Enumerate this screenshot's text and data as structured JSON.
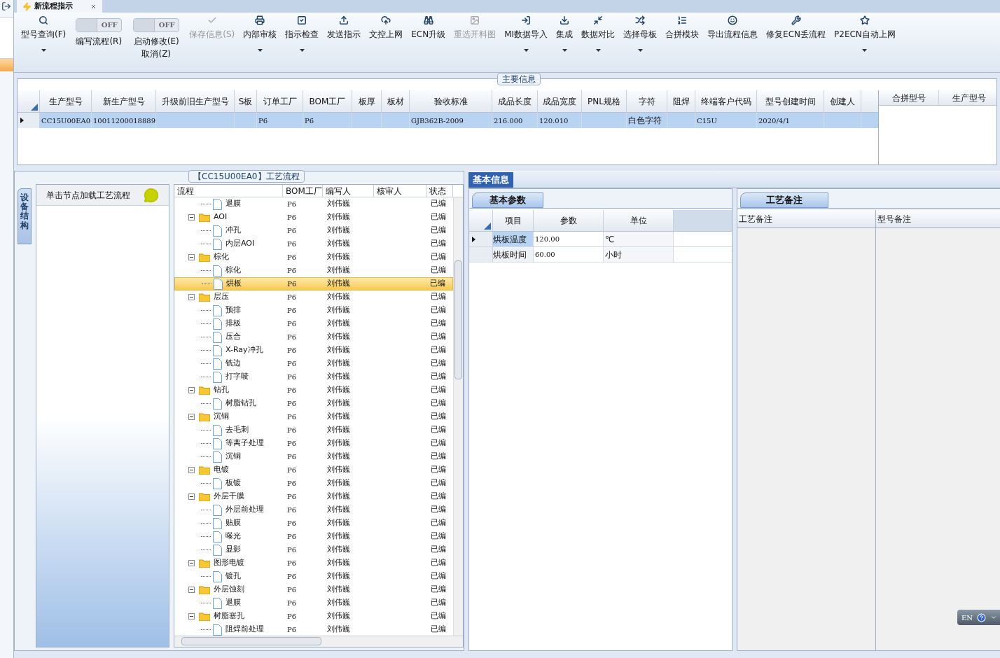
{
  "window": {
    "tab_title": "新流程指示"
  },
  "toolbar": [
    {
      "kind": "button",
      "label": "型号查询(F)",
      "disabled": false,
      "dropdown": true
    },
    {
      "kind": "toggle",
      "label": "编写流程(R)",
      "state_text": "OFF",
      "on": false
    },
    {
      "kind": "toggle",
      "label": "启动修改(E)",
      "sub_label": "取消(Z)",
      "state_text": "OFF",
      "on": false
    },
    {
      "kind": "button",
      "label": "保存信息(S)",
      "disabled": true,
      "dropdown": false
    },
    {
      "kind": "button",
      "label": "内部审核",
      "disabled": false,
      "dropdown": true
    },
    {
      "kind": "button",
      "label": "指示检查",
      "disabled": false,
      "dropdown": true
    },
    {
      "kind": "button",
      "label": "发送指示",
      "disabled": false,
      "dropdown": false
    },
    {
      "kind": "button",
      "label": "文控上网",
      "disabled": false,
      "dropdown": false
    },
    {
      "kind": "button",
      "label": "ECN升级",
      "disabled": false,
      "dropdown": false
    },
    {
      "kind": "button",
      "label": "重选开料图",
      "disabled": true,
      "dropdown": false
    },
    {
      "kind": "button",
      "label": "MI数据导入",
      "disabled": false,
      "dropdown": true
    },
    {
      "kind": "button",
      "label": "集成",
      "disabled": false,
      "dropdown": true
    },
    {
      "kind": "button",
      "label": "数据对比",
      "disabled": false,
      "dropdown": true
    },
    {
      "kind": "button",
      "label": "选择母板",
      "disabled": false,
      "dropdown": true
    },
    {
      "kind": "button",
      "label": "合拼模块",
      "disabled": false,
      "dropdown": false
    },
    {
      "kind": "button",
      "label": "导出流程信息",
      "disabled": false,
      "dropdown": false
    },
    {
      "kind": "button",
      "label": "修复ECN丢流程",
      "disabled": false,
      "dropdown": false
    },
    {
      "kind": "button",
      "label": "P2ECN自动上网",
      "disabled": false,
      "dropdown": true
    }
  ],
  "main_info": {
    "title": "主要信息",
    "columns": [
      "生产型号",
      "新生产型号",
      "升级前旧生产型号",
      "S板",
      "订单工厂",
      "BOM工厂",
      "板厚",
      "板材",
      "验收标准",
      "成品长度",
      "成品宽度",
      "PNL规格",
      "字符",
      "阻焊",
      "终端客户代码",
      "型号创建时间",
      "创建人"
    ],
    "rows": [
      {
        "selected": true,
        "cells": [
          "CC15U00EA0",
          "10011200018889",
          "",
          "",
          "P6",
          "P6",
          "",
          "",
          "GJB362B-2009",
          "216.000",
          "120.010",
          "",
          "白色字符",
          "",
          "C15U",
          "2020/4/1",
          ""
        ]
      }
    ],
    "side_columns": [
      "合拼型号",
      "生产型号"
    ]
  },
  "process": {
    "title": "【CC15U00EA0】工艺流程",
    "side_tab": "设备结构",
    "hint": "单击节点加载工艺流程",
    "columns": [
      "流程",
      "BOM工厂",
      "编写人",
      "核审人",
      "状态"
    ],
    "tree": [
      {
        "children": [
          {
            "label": "退膜",
            "bom": "P6",
            "writer": "刘伟巍",
            "status": "已编",
            "selected": false
          }
        ]
      },
      {
        "label": "AOI",
        "bom": "P6",
        "writer": "刘伟巍",
        "status": "已编",
        "expanded": true,
        "children": [
          {
            "label": "冲孔",
            "bom": "P6",
            "writer": "刘伟巍",
            "status": "已编",
            "selected": false
          },
          {
            "label": "内层AOI",
            "bom": "P6",
            "writer": "刘伟巍",
            "status": "已编",
            "selected": false
          }
        ]
      },
      {
        "label": "棕化",
        "bom": "P6",
        "writer": "刘伟巍",
        "status": "已编",
        "expanded": true,
        "children": [
          {
            "label": "棕化",
            "bom": "P6",
            "writer": "刘伟巍",
            "status": "已编",
            "selected": false
          },
          {
            "label": "烘板",
            "bom": "P6",
            "writer": "刘伟巍",
            "status": "已编",
            "selected": true
          }
        ]
      },
      {
        "label": "层压",
        "bom": "P6",
        "writer": "刘伟巍",
        "status": "已编",
        "expanded": true,
        "children": [
          {
            "label": "预排",
            "bom": "P6",
            "writer": "刘伟巍",
            "status": "已编",
            "selected": false
          },
          {
            "label": "排板",
            "bom": "P6",
            "writer": "刘伟巍",
            "status": "已编",
            "selected": false
          },
          {
            "label": "压合",
            "bom": "P6",
            "writer": "刘伟巍",
            "status": "已编",
            "selected": false
          },
          {
            "label": "X-Ray冲孔",
            "bom": "P6",
            "writer": "刘伟巍",
            "status": "已编",
            "selected": false
          },
          {
            "label": "铣边",
            "bom": "P6",
            "writer": "刘伟巍",
            "status": "已编",
            "selected": false
          },
          {
            "label": "打字唛",
            "bom": "P6",
            "writer": "刘伟巍",
            "status": "已编",
            "selected": false
          }
        ]
      },
      {
        "label": "钻孔",
        "bom": "P6",
        "writer": "刘伟巍",
        "status": "已编",
        "expanded": true,
        "children": [
          {
            "label": "树脂钻孔",
            "bom": "P6",
            "writer": "刘伟巍",
            "status": "已编",
            "selected": false
          }
        ]
      },
      {
        "label": "沉铜",
        "bom": "P6",
        "writer": "刘伟巍",
        "status": "已编",
        "expanded": true,
        "children": [
          {
            "label": "去毛刺",
            "bom": "P6",
            "writer": "刘伟巍",
            "status": "已编",
            "selected": false
          },
          {
            "label": "等离子处理",
            "bom": "P6",
            "writer": "刘伟巍",
            "status": "已编",
            "selected": false
          },
          {
            "label": "沉铜",
            "bom": "P6",
            "writer": "刘伟巍",
            "status": "已编",
            "selected": false
          }
        ]
      },
      {
        "label": "电镀",
        "bom": "P6",
        "writer": "刘伟巍",
        "status": "已编",
        "expanded": true,
        "children": [
          {
            "label": "板镀",
            "bom": "P6",
            "writer": "刘伟巍",
            "status": "已编",
            "selected": false
          }
        ]
      },
      {
        "label": "外层干膜",
        "bom": "P6",
        "writer": "刘伟巍",
        "status": "已编",
        "expanded": true,
        "children": [
          {
            "label": "外层前处理",
            "bom": "P6",
            "writer": "刘伟巍",
            "status": "已编",
            "selected": false
          },
          {
            "label": "贴膜",
            "bom": "P6",
            "writer": "刘伟巍",
            "status": "已编",
            "selected": false
          },
          {
            "label": "曝光",
            "bom": "P6",
            "writer": "刘伟巍",
            "status": "已编",
            "selected": false
          },
          {
            "label": "显影",
            "bom": "P6",
            "writer": "刘伟巍",
            "status": "已编",
            "selected": false
          }
        ]
      },
      {
        "label": "图形电镀",
        "bom": "P6",
        "writer": "刘伟巍",
        "status": "已编",
        "expanded": true,
        "children": [
          {
            "label": "镀孔",
            "bom": "P6",
            "writer": "刘伟巍",
            "status": "已编",
            "selected": false
          }
        ]
      },
      {
        "label": "外层蚀刻",
        "bom": "P6",
        "writer": "刘伟巍",
        "status": "已编",
        "expanded": true,
        "children": [
          {
            "label": "退膜",
            "bom": "P6",
            "writer": "刘伟巍",
            "status": "已编",
            "selected": false
          }
        ]
      },
      {
        "label": "树脂塞孔",
        "bom": "P6",
        "writer": "刘伟巍",
        "status": "已编",
        "expanded": true,
        "children": [
          {
            "label": "阻焊前处理",
            "bom": "P6",
            "writer": "刘伟巍",
            "status": "已编",
            "selected": false
          }
        ]
      }
    ]
  },
  "basic_info": {
    "tab": "基本信息",
    "sub_tab": "基本参数",
    "columns": [
      "项目",
      "参数",
      "单位"
    ],
    "rows": [
      {
        "item": "烘板温度",
        "value": "120.00",
        "unit": "℃",
        "selected": true
      },
      {
        "item": "烘板时间",
        "value": "60.00",
        "unit": "小时",
        "selected": false
      }
    ]
  },
  "remarks": {
    "tab": "工艺备注",
    "columns": [
      "工艺备注",
      "型号备注"
    ]
  },
  "language_bar": {
    "label": "EN"
  }
}
